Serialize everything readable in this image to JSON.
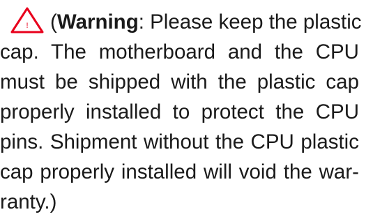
{
  "warning_icon": {
    "icon": "warning-triangle-icon",
    "glyph": "!",
    "stroke_color": "#e8001c",
    "glyph_color": "#e8001c"
  },
  "paragraph": {
    "open_paren": "(",
    "warning_label": "Warning",
    "lines": [
      ": Please keep the plastic",
      "cap. The motherboard and the CPU",
      "must be shipped with the plastic cap",
      "properly installed to protect the CPU",
      "pins. Shipment without the CPU plastic",
      "cap properly installed will void the war-",
      "ranty.)"
    ]
  }
}
